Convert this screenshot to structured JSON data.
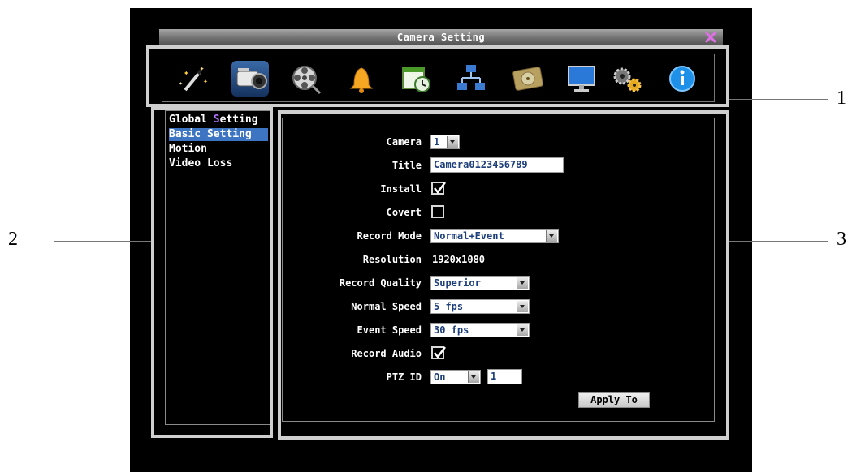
{
  "window": {
    "title": "Camera Setting"
  },
  "toolbar": {
    "icons": [
      "magic-wand",
      "camera",
      "film-reel",
      "bell",
      "calendar-clock",
      "network",
      "hard-drive",
      "monitor",
      "gears",
      "info"
    ],
    "active": "camera"
  },
  "menu": {
    "items": [
      {
        "pre": "Global ",
        "hl": "S",
        "post": "etting"
      },
      {
        "label": "Basic Setting"
      },
      {
        "label": "Motion"
      },
      {
        "label": "Video Loss"
      }
    ]
  },
  "form": {
    "camera_label": "Camera",
    "camera_value": "1",
    "title_label": "Title",
    "title_value": "Camera0123456789",
    "install_label": "Install",
    "install_checked": true,
    "covert_label": "Covert",
    "covert_checked": false,
    "record_mode_label": "Record Mode",
    "record_mode_value": "Normal+Event",
    "resolution_label": "Resolution",
    "resolution_value": "1920x1080",
    "record_quality_label": "Record Quality",
    "record_quality_value": "Superior",
    "normal_speed_label": "Normal Speed",
    "normal_speed_value": "5 fps",
    "event_speed_label": "Event Speed",
    "event_speed_value": "30 fps",
    "record_audio_label": "Record Audio",
    "record_audio_checked": true,
    "ptz_id_label": "PTZ ID",
    "ptz_id_mode": "On",
    "ptz_id_value": "1",
    "apply_to_label": "Apply To"
  },
  "callouts": {
    "one": "1",
    "two": "2",
    "three": "3"
  },
  "colors": {
    "selection": "#3d75c2",
    "title_bar": "#7a7a7a",
    "field_text": "#1c3e7a"
  }
}
